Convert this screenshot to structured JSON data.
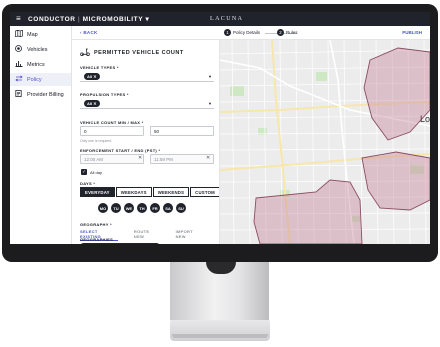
{
  "app": {
    "menu_icon": "hamburger-icon",
    "title_left": "CONDUCTOR",
    "title_sep": "|",
    "title_right": "MICROMOBILITY",
    "title_caret": "▾",
    "brand": "LACUNA"
  },
  "sidebar": {
    "items": [
      {
        "label": "Map",
        "icon": "map-icon",
        "glyph": "🗺"
      },
      {
        "label": "Vehicles",
        "icon": "vehicle-icon",
        "glyph": "◉"
      },
      {
        "label": "Metrics",
        "icon": "metrics-icon",
        "glyph": "▥"
      },
      {
        "label": "Policy",
        "icon": "policy-icon",
        "glyph": "⇆",
        "active": true
      },
      {
        "label": "Provider Billing",
        "icon": "billing-icon",
        "glyph": "▤"
      }
    ]
  },
  "subheader": {
    "back": "‹ BACK",
    "steps": [
      {
        "num": "1",
        "label": "Policy Details"
      },
      {
        "num": "2",
        "label": "Rules"
      }
    ],
    "publish": "PUBLISH"
  },
  "panel": {
    "title": "PERMITTED VEHICLE COUNT",
    "title_icon": "scooter-icon",
    "vehicle_types_label": "VEHICLE TYPES *",
    "vehicle_types_value": "All ✕",
    "propulsion_label": "PROPULSION TYPES *",
    "propulsion_value": "All ✕",
    "count_label": "VEHICLE COUNT MIN / MAX *",
    "count_min": "0",
    "count_max": "50",
    "count_hint": "Only one is required",
    "enforcement_label": "ENFORCEMENT START / END (PST) *",
    "enforcement_start": "12:00 AM",
    "enforcement_end": "11:59 PM",
    "all_day": "All day",
    "days_label": "DAYS *",
    "day_modes": [
      "EVERYDAY",
      "WEEKDAYS",
      "WEEKENDS",
      "CUSTOM"
    ],
    "day_mode_selected": "EVERYDAY",
    "days": [
      "MO",
      "TU",
      "WE",
      "TH",
      "FR",
      "SA",
      "SU"
    ],
    "geography_label": "GEOGRAPHY *",
    "geo_tabs": [
      "SELECT EXISTING",
      "ROUTE NEW",
      "IMPORT NEW"
    ],
    "geo_tab_selected": "SELECT EXISTING",
    "geographies_label": "GEOGRAPHIES"
  },
  "map": {
    "city_label": "Lo",
    "zone_color": "#c98ba0",
    "water_color": "#bcd8ef",
    "park_color": "#cfe8c4"
  }
}
